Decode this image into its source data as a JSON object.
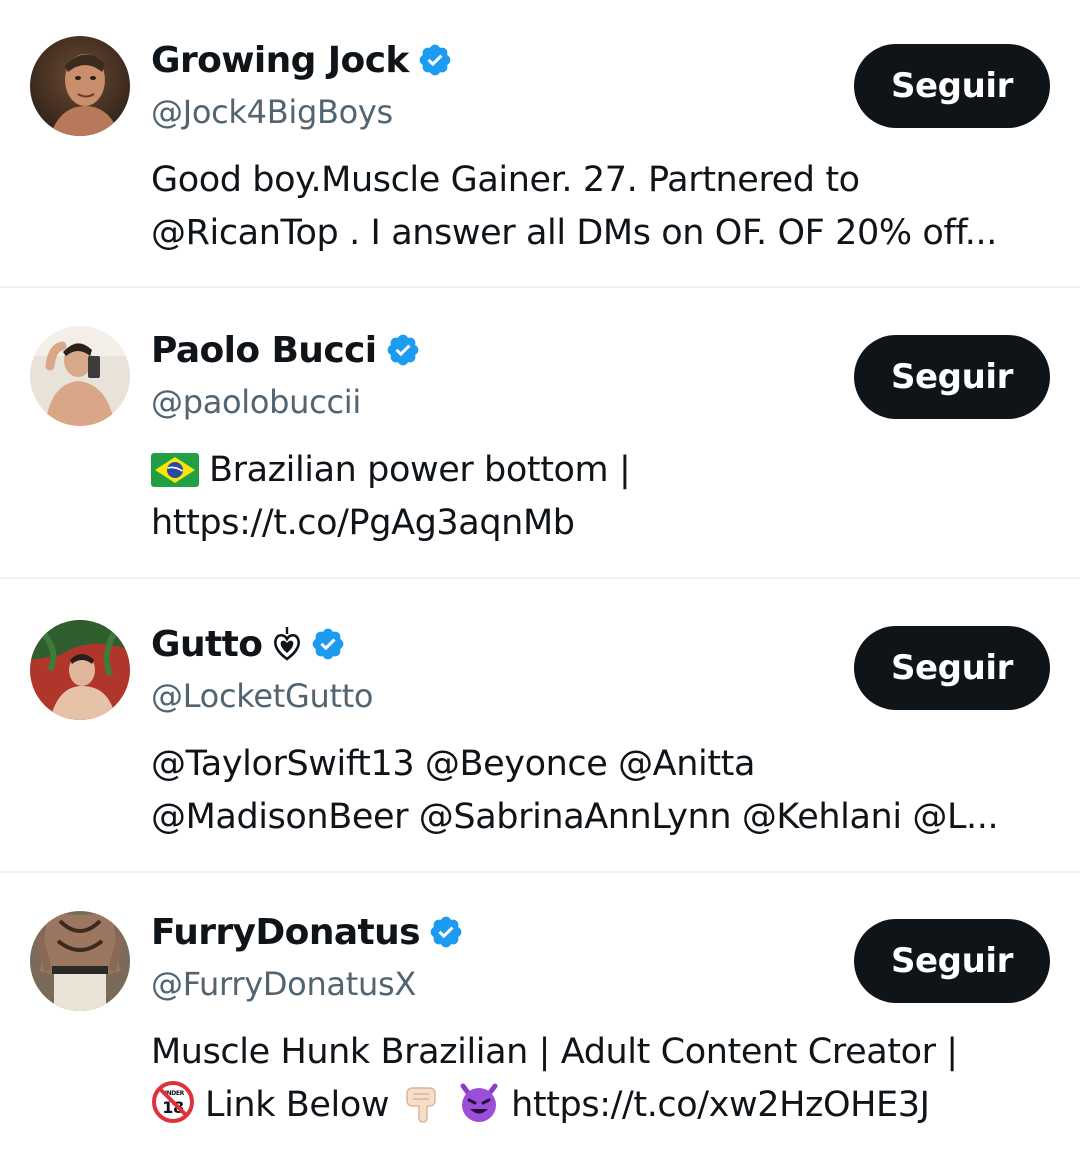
{
  "follow_label": "Seguir",
  "colors": {
    "verified": "#1d9bf0",
    "text_primary": "#0f1419",
    "text_secondary": "#536471",
    "divider": "#eff3f4",
    "button_bg": "#0f1419",
    "button_text": "#ffffff"
  },
  "accounts": [
    {
      "name": "Growing Jock",
      "handle": "@Jock4BigBoys",
      "verified": true,
      "bio": [
        "Good boy.Muscle Gainer. 27. Partnered to",
        "@RicanTop . I answer all DMs on OF. OF 20% off..."
      ]
    },
    {
      "name": "Paolo Bucci",
      "handle": "@paolobuccii",
      "verified": true,
      "bio_icon": "brazil-flag-icon",
      "bio": [
        "Brazilian power bottom |",
        "https://t.co/PgAg3aqnMb"
      ]
    },
    {
      "name": "Gutto",
      "name_icon": "locket-heart-icon",
      "handle": "@LocketGutto",
      "verified": true,
      "bio": [
        "@TaylorSwift13 @Beyonce @Anitta",
        "@MadisonBeer @SabrinaAnnLynn @Kehlani @L..."
      ]
    },
    {
      "name": "FurryDonatus",
      "handle": "@FurryDonatusX",
      "verified": true,
      "bio_icons": [
        "no-under-18-icon",
        "pointing-down-icon",
        "smiling-devil-icon"
      ],
      "bio": [
        "Muscle Hunk Brazilian | Adult Content Creator |",
        "Link Below",
        "https://t.co/xw2HzOHE3J"
      ]
    }
  ]
}
